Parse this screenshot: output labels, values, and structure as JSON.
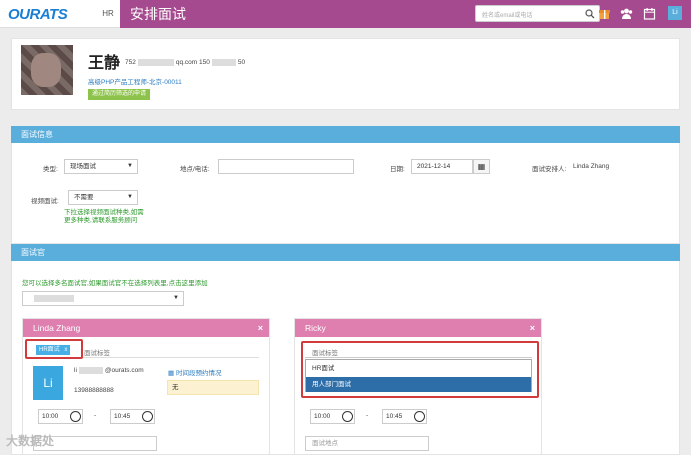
{
  "header": {
    "logo_main": "OURATS",
    "hr_tab": "HR",
    "page_title": "安排面试",
    "search_placeholder": "姓名或email或电话",
    "user_initials": "Li"
  },
  "candidate": {
    "name": "王静",
    "email_prefix": "752",
    "email_suffix": "qq.com",
    "phone_prefix": "150",
    "phone_suffix": "50",
    "job": "高级PHP产品工程师-北京-00011",
    "passed_badge": "通过简历筛选的申请"
  },
  "interview_info": {
    "section_title": "面试信息",
    "type_label": "类型:",
    "type_value": "现场面试",
    "location_label": "地点/电话:",
    "date_label": "日期:",
    "date_value": "2021-12-14",
    "arranger_label": "面试安排人:",
    "arranger_value": "Linda Zhang",
    "video_label": "视频面试:",
    "video_value": "不需要",
    "video_hint": "下拉选择视频面试种类,如需更多种类,请联系服务顾问"
  },
  "interviewers": {
    "section_title": "面试官",
    "add_hint": "您可以选择多名面试官,如果面试官不在选择列表里,点击这里添加",
    "panels": [
      {
        "name": "Linda Zhang",
        "close": "×",
        "tag": "HR面试",
        "tag_close": "x",
        "tag_placeholder": "面试标签",
        "avatar": "Li",
        "email_prefix": "li",
        "email_suffix": "@ourats.com",
        "phone": "13988888888",
        "schedule_link": "时间段预约情况",
        "schedule_value": "无",
        "start_time": "10:00",
        "end_time": "10:45",
        "dash": "-"
      },
      {
        "name": "Ricky",
        "close": "×",
        "tag_placeholder": "面试标签",
        "start_time": "10:00",
        "end_time": "10:45",
        "dash": "-",
        "location_placeholder": "面试地点",
        "dropdown": [
          "HR面试",
          "用人部门面试"
        ]
      }
    ]
  },
  "watermark": "大数据处"
}
